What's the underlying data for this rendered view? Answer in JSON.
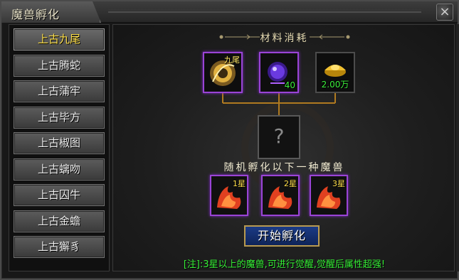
{
  "window": {
    "title": "魔兽孵化",
    "close_label": "×"
  },
  "beast_list": {
    "items": [
      {
        "label": "上古九尾",
        "active": true
      },
      {
        "label": "上古腾蛇",
        "active": false
      },
      {
        "label": "上古蒲牢",
        "active": false
      },
      {
        "label": "上古毕方",
        "active": false
      },
      {
        "label": "上古椒图",
        "active": false
      },
      {
        "label": "上古螭吻",
        "active": false
      },
      {
        "label": "上古囚牛",
        "active": false
      },
      {
        "label": "上古金蟾",
        "active": false
      },
      {
        "label": "上古獬豸",
        "active": false
      }
    ]
  },
  "materials": {
    "title": "材料消耗",
    "beast_material_tag": "九尾",
    "crystal_count": "40",
    "gold_cost": "2.00万"
  },
  "result": {
    "unknown_label": "?"
  },
  "eggs": {
    "title": "随机孵化以下一种魔兽",
    "stars": [
      "1星",
      "2星",
      "3星"
    ]
  },
  "actions": {
    "start_label": "开始孵化"
  },
  "note": "[注]:3星以上的魔兽,可进行觉醒,觉醒后属性超强!",
  "colors": {
    "highlight_yellow": "#ffe04a",
    "count_green": "#3df03d",
    "rarity_purple": "#9a44d6",
    "button_blue": "#1b3b86"
  }
}
